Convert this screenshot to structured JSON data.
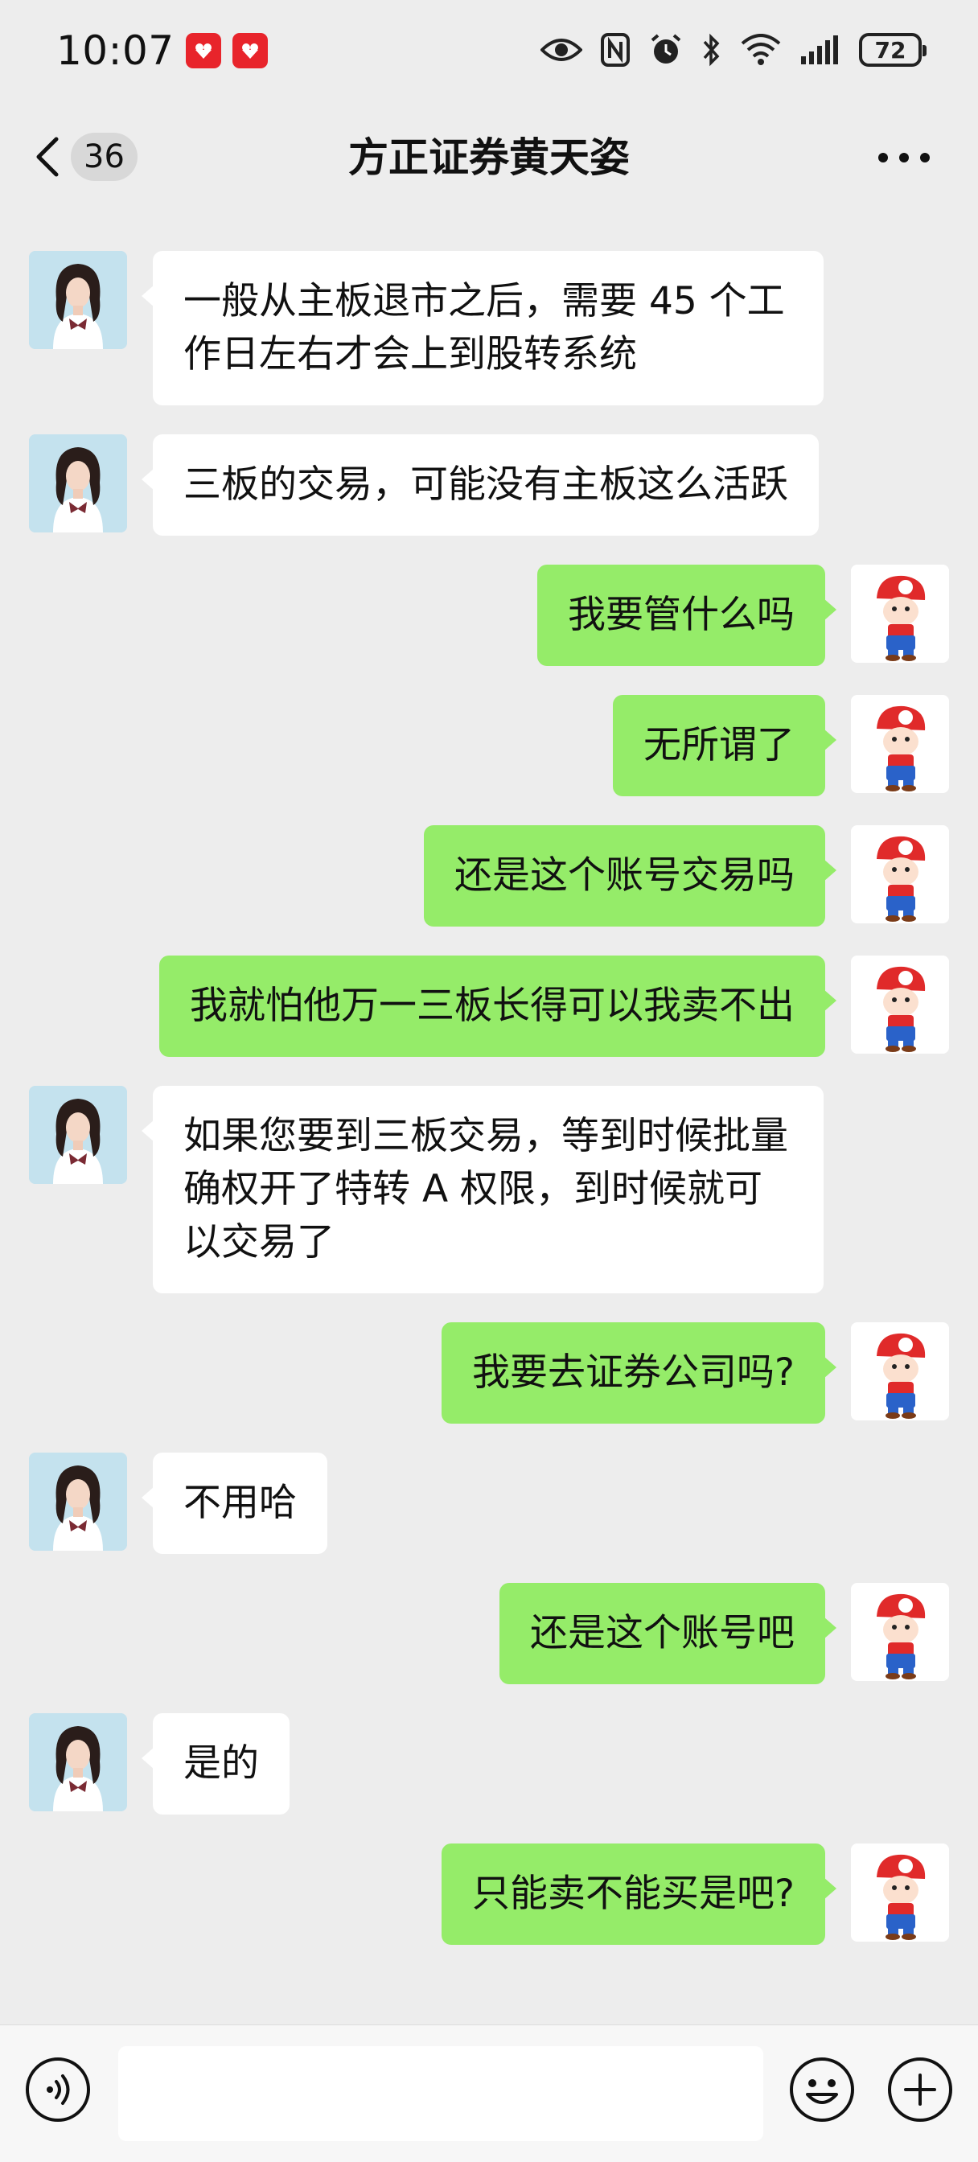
{
  "status_bar": {
    "time": "10:07",
    "battery": "72",
    "icons": [
      "notification-badge-icon",
      "notification-badge-icon",
      "eye-icon",
      "nfc-icon",
      "alarm-icon",
      "bluetooth-icon",
      "wifi-icon",
      "signal-icon",
      "battery-icon"
    ]
  },
  "nav": {
    "unread_count": "36",
    "title": "方正证券黄天姿",
    "back_icon": "chevron-left-icon",
    "more_icon": "more-dots-icon"
  },
  "messages": [
    {
      "side": "in",
      "text": "一般从主板退市之后，需要 45 个工作日左右才会上到股转系统"
    },
    {
      "side": "in",
      "text": "三板的交易，可能没有主板这么活跃"
    },
    {
      "side": "out",
      "text": "我要管什么吗"
    },
    {
      "side": "out",
      "text": "无所谓了"
    },
    {
      "side": "out",
      "text": "还是这个账号交易吗"
    },
    {
      "side": "out",
      "text": "我就怕他万一三板长得可以我卖不出"
    },
    {
      "side": "in",
      "text": "如果您要到三板交易，等到时候批量确权开了特转 A 权限，到时候就可以交易了"
    },
    {
      "side": "out",
      "text": "我要去证券公司吗?"
    },
    {
      "side": "in",
      "text": "不用哈"
    },
    {
      "side": "out",
      "text": "还是这个账号吧"
    },
    {
      "side": "in",
      "text": "是的"
    },
    {
      "side": "out",
      "text": "只能卖不能买是吧?"
    }
  ],
  "input_bar": {
    "value": "",
    "voice_icon": "voice-icon",
    "emoji_icon": "emoji-icon",
    "plus_icon": "plus-icon"
  },
  "colors": {
    "background": "#ededed",
    "outgoing_bubble": "#95ec69",
    "incoming_bubble": "#ffffff",
    "badge_red": "#e8242b"
  }
}
